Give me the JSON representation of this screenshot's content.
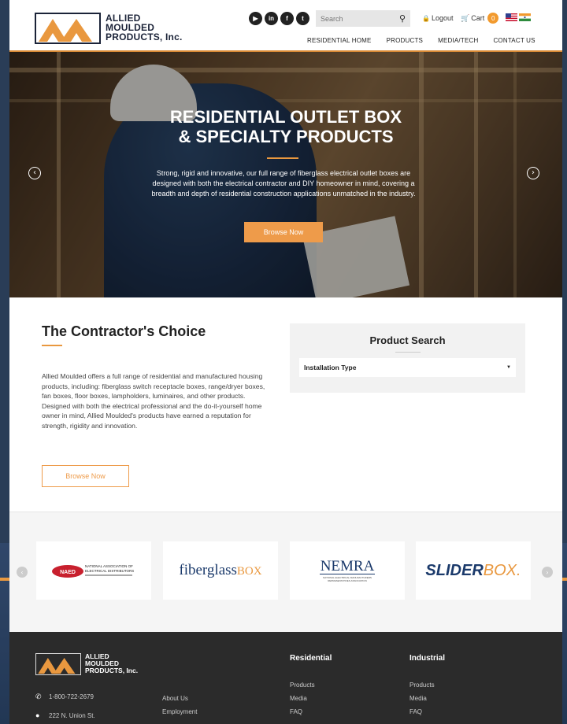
{
  "brand": {
    "name_line1": "ALLIED",
    "name_line2": "MOULDED",
    "name_line3": "PRODUCTS, Inc.",
    "accent_color": "#e9983f",
    "navy_color": "#1b2338"
  },
  "header": {
    "socials": [
      {
        "icon": "youtube-icon",
        "glyph": "▶"
      },
      {
        "icon": "linkedin-icon",
        "glyph": "in"
      },
      {
        "icon": "facebook-icon",
        "glyph": "f"
      },
      {
        "icon": "twitter-icon",
        "glyph": "t"
      }
    ],
    "search_placeholder": "Search",
    "logout_label": "Logout",
    "cart_label": "Cart",
    "cart_count": "0",
    "flags": [
      "us-flag-icon",
      "india-flag-icon"
    ]
  },
  "nav": {
    "items": [
      "RESIDENTIAL HOME",
      "PRODUCTS",
      "MEDIA/TECH",
      "CONTACT US"
    ]
  },
  "hero": {
    "title_line1": "RESIDENTIAL OUTLET BOX",
    "title_line2": "& SPECIALTY PRODUCTS",
    "body": "Strong, rigid and innovative, our full range of fiberglass electrical outlet boxes are designed with both the electrical contractor and DIY homeowner in mind, covering a breadth and depth of residential construction applications unmatched in the industry.",
    "button_label": "Browse Now"
  },
  "contractor": {
    "title": "The Contractor's Choice",
    "body": "Allied Moulded offers a full range of residential and manufactured housing products, including: fiberglass switch receptacle boxes, range/dryer boxes, fan boxes, floor boxes, lampholders, luminaires, and other products. Designed with both the electrical professional and the do-it-yourself home owner in mind, Allied Moulded's products have earned a reputation for strength, rigidity and innovation.",
    "button_label": "Browse Now"
  },
  "product_search": {
    "title": "Product Search",
    "select_value": "Installation Type"
  },
  "partners": {
    "naed_line1": "NATIONAL ASSOCIATION OF",
    "naed_line2": "ELECTRICAL DISTRIBUTORS",
    "naed_badge": "NAED",
    "fiberglass_word": "fiberglass",
    "fiberglass_box": "BOX",
    "nemra": "NEMRA",
    "nemra_sub": "NATIONAL ELECTRICAL MANUFACTURERS REPRESENTATIVES ASSOCIATION",
    "slider": "SLIDER",
    "slider_box": "BOX."
  },
  "footer": {
    "logo_line1": "ALLIED",
    "logo_line2": "MOULDED",
    "logo_line3": "PRODUCTS, Inc.",
    "phone": "1-800-722-2679",
    "address": "222 N. Union St.",
    "col_links": [
      "About Us",
      "Employment"
    ],
    "residential_heading": "Residential",
    "residential_links": [
      "Products",
      "Media",
      "FAQ"
    ],
    "industrial_heading": "Industrial",
    "industrial_links": [
      "Products",
      "Media",
      "FAQ"
    ]
  }
}
